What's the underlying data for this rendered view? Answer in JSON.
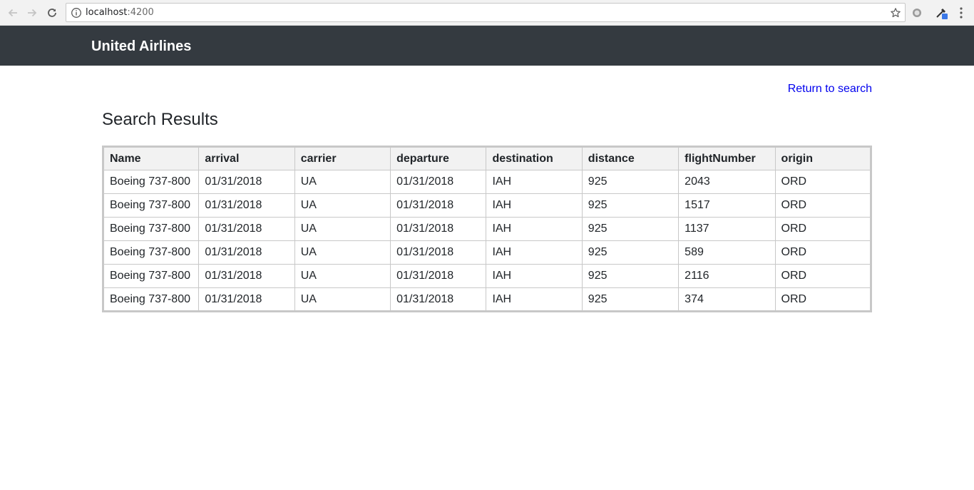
{
  "browser": {
    "url_host": "localhost",
    "url_port": ":4200"
  },
  "navbar": {
    "brand": "United Airlines"
  },
  "page": {
    "return_link": "Return to search",
    "title": "Search Results"
  },
  "table": {
    "headers": [
      "Name",
      "arrival",
      "carrier",
      "departure",
      "destination",
      "distance",
      "flightNumber",
      "origin"
    ],
    "rows": [
      [
        "Boeing 737-800",
        "01/31/2018",
        "UA",
        "01/31/2018",
        "IAH",
        "925",
        "2043",
        "ORD"
      ],
      [
        "Boeing 737-800",
        "01/31/2018",
        "UA",
        "01/31/2018",
        "IAH",
        "925",
        "1517",
        "ORD"
      ],
      [
        "Boeing 737-800",
        "01/31/2018",
        "UA",
        "01/31/2018",
        "IAH",
        "925",
        "1137",
        "ORD"
      ],
      [
        "Boeing 737-800",
        "01/31/2018",
        "UA",
        "01/31/2018",
        "IAH",
        "925",
        "589",
        "ORD"
      ],
      [
        "Boeing 737-800",
        "01/31/2018",
        "UA",
        "01/31/2018",
        "IAH",
        "925",
        "2116",
        "ORD"
      ],
      [
        "Boeing 737-800",
        "01/31/2018",
        "UA",
        "01/31/2018",
        "IAH",
        "925",
        "374",
        "ORD"
      ]
    ]
  },
  "colors": {
    "navbar": "#343a40",
    "link": "#0000ee",
    "table_border": "#c8c8c8",
    "table_header_bg": "#f2f2f2"
  },
  "icons": [
    "back-arrow-icon",
    "forward-arrow-icon",
    "reload-icon",
    "info-icon",
    "star-icon",
    "extension-icon",
    "eyedropper-extension-icon",
    "more-vert-icon"
  ]
}
